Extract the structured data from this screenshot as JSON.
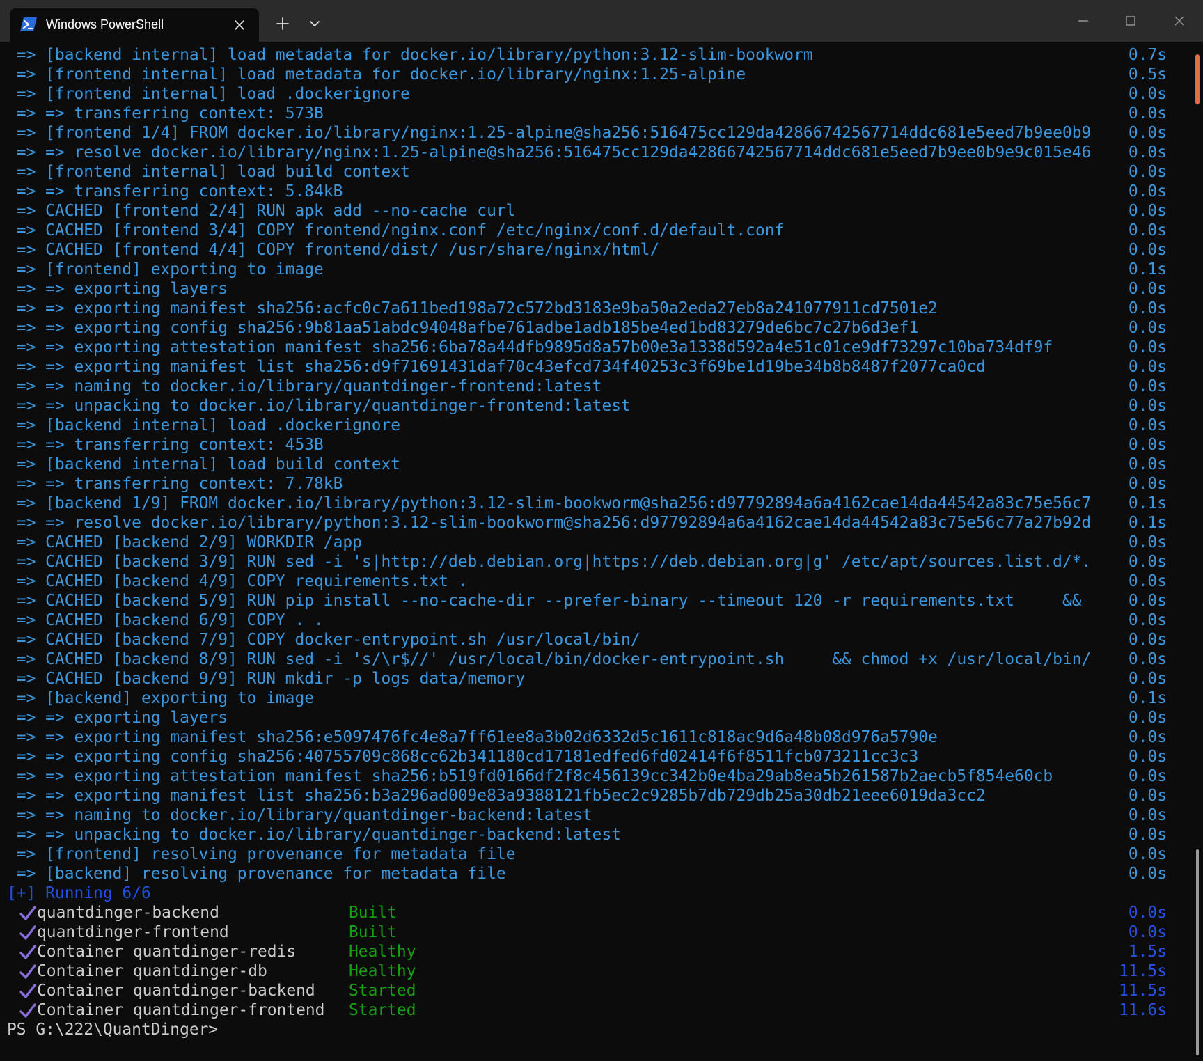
{
  "titlebar": {
    "tab_title": "Windows PowerShell",
    "tab_icon": "powershell-icon",
    "new_tab_icon": "plus-icon",
    "dropdown_icon": "chevron-down-icon",
    "minimize_icon": "minimize-icon",
    "maximize_icon": "maximize-icon",
    "close_icon": "close-icon"
  },
  "log": [
    {
      "text": " => [backend internal] load metadata for docker.io/library/python:3.12-slim-bookworm",
      "time": "0.7s"
    },
    {
      "text": " => [frontend internal] load metadata for docker.io/library/nginx:1.25-alpine",
      "time": "0.5s"
    },
    {
      "text": " => [frontend internal] load .dockerignore",
      "time": "0.0s"
    },
    {
      "text": " => => transferring context: 573B",
      "time": "0.0s"
    },
    {
      "text": " => [frontend 1/4] FROM docker.io/library/nginx:1.25-alpine@sha256:516475cc129da42866742567714ddc681e5eed7b9ee0b9",
      "time": "0.0s"
    },
    {
      "text": " => => resolve docker.io/library/nginx:1.25-alpine@sha256:516475cc129da42866742567714ddc681e5eed7b9ee0b9e9c015e46",
      "time": "0.0s"
    },
    {
      "text": " => [frontend internal] load build context",
      "time": "0.0s"
    },
    {
      "text": " => => transferring context: 5.84kB",
      "time": "0.0s"
    },
    {
      "text": " => CACHED [frontend 2/4] RUN apk add --no-cache curl",
      "time": "0.0s"
    },
    {
      "text": " => CACHED [frontend 3/4] COPY frontend/nginx.conf /etc/nginx/conf.d/default.conf",
      "time": "0.0s"
    },
    {
      "text": " => CACHED [frontend 4/4] COPY frontend/dist/ /usr/share/nginx/html/",
      "time": "0.0s"
    },
    {
      "text": " => [frontend] exporting to image",
      "time": "0.1s"
    },
    {
      "text": " => => exporting layers",
      "time": "0.0s"
    },
    {
      "text": " => => exporting manifest sha256:acfc0c7a611bed198a72c572bd3183e9ba50a2eda27eb8a241077911cd7501e2",
      "time": "0.0s"
    },
    {
      "text": " => => exporting config sha256:9b81aa51abdc94048afbe761adbe1adb185be4ed1bd83279de6bc7c27b6d3ef1",
      "time": "0.0s"
    },
    {
      "text": " => => exporting attestation manifest sha256:6ba78a44dfb9895d8a57b00e3a1338d592a4e51c01ce9df73297c10ba734df9f",
      "time": "0.0s"
    },
    {
      "text": " => => exporting manifest list sha256:d9f71691431daf70c43efcd734f40253c3f69be1d19be34b8b8487f2077ca0cd",
      "time": "0.0s"
    },
    {
      "text": " => => naming to docker.io/library/quantdinger-frontend:latest",
      "time": "0.0s"
    },
    {
      "text": " => => unpacking to docker.io/library/quantdinger-frontend:latest",
      "time": "0.0s"
    },
    {
      "text": " => [backend internal] load .dockerignore",
      "time": "0.0s"
    },
    {
      "text": " => => transferring context: 453B",
      "time": "0.0s"
    },
    {
      "text": " => [backend internal] load build context",
      "time": "0.0s"
    },
    {
      "text": " => => transferring context: 7.78kB",
      "time": "0.0s"
    },
    {
      "text": " => [backend 1/9] FROM docker.io/library/python:3.12-slim-bookworm@sha256:d97792894a6a4162cae14da44542a83c75e56c7",
      "time": "0.1s"
    },
    {
      "text": " => => resolve docker.io/library/python:3.12-slim-bookworm@sha256:d97792894a6a4162cae14da44542a83c75e56c77a27b92d",
      "time": "0.1s"
    },
    {
      "text": " => CACHED [backend 2/9] WORKDIR /app",
      "time": "0.0s"
    },
    {
      "text": " => CACHED [backend 3/9] RUN sed -i 's|http://deb.debian.org|https://deb.debian.org|g' /etc/apt/sources.list.d/*.",
      "time": "0.0s"
    },
    {
      "text": " => CACHED [backend 4/9] COPY requirements.txt .",
      "time": "0.0s"
    },
    {
      "text": " => CACHED [backend 5/9] RUN pip install --no-cache-dir --prefer-binary --timeout 120 -r requirements.txt     &&",
      "time": "0.0s"
    },
    {
      "text": " => CACHED [backend 6/9] COPY . .",
      "time": "0.0s"
    },
    {
      "text": " => CACHED [backend 7/9] COPY docker-entrypoint.sh /usr/local/bin/",
      "time": "0.0s"
    },
    {
      "text": " => CACHED [backend 8/9] RUN sed -i 's/\\r$//' /usr/local/bin/docker-entrypoint.sh     && chmod +x /usr/local/bin/",
      "time": "0.0s"
    },
    {
      "text": " => CACHED [backend 9/9] RUN mkdir -p logs data/memory",
      "time": "0.0s"
    },
    {
      "text": " => [backend] exporting to image",
      "time": "0.1s"
    },
    {
      "text": " => => exporting layers",
      "time": "0.0s"
    },
    {
      "text": " => => exporting manifest sha256:e5097476fc4e8a7ff61ee8a3b02d6332d5c1611c818ac9d6a48b08d976a5790e",
      "time": "0.0s"
    },
    {
      "text": " => => exporting config sha256:40755709c868cc62b341180cd17181edfed6fd02414f6f8511fcb073211cc3c3",
      "time": "0.0s"
    },
    {
      "text": " => => exporting attestation manifest sha256:b519fd0166df2f8c456139cc342b0e4ba29ab8ea5b261587b2aecb5f854e60cb",
      "time": "0.0s"
    },
    {
      "text": " => => exporting manifest list sha256:b3a296ad009e83a9388121fb5ec2c9285b7db729db25a30db21eee6019da3cc2",
      "time": "0.0s"
    },
    {
      "text": " => => naming to docker.io/library/quantdinger-backend:latest",
      "time": "0.0s"
    },
    {
      "text": " => => unpacking to docker.io/library/quantdinger-backend:latest",
      "time": "0.0s"
    },
    {
      "text": " => [frontend] resolving provenance for metadata file",
      "time": "0.0s"
    },
    {
      "text": " => [backend] resolving provenance for metadata file",
      "time": "0.0s"
    }
  ],
  "running_header": "[+] Running 6/6",
  "check_icon": "checkmark-icon",
  "status_rows": [
    {
      "name": "quantdinger-backend",
      "status": "Built",
      "time": "0.0s"
    },
    {
      "name": "quantdinger-frontend",
      "status": "Built",
      "time": "0.0s"
    },
    {
      "name": "Container quantdinger-redis",
      "status": "Healthy",
      "time": "1.5s"
    },
    {
      "name": "Container quantdinger-db",
      "status": "Healthy",
      "time": "11.5s"
    },
    {
      "name": "Container quantdinger-backend",
      "status": "Started",
      "time": "11.5s"
    },
    {
      "name": "Container quantdinger-frontend",
      "status": "Started",
      "time": "11.6s"
    }
  ],
  "prompt": "PS G:\\222\\QuantDinger>",
  "colors": {
    "log_text": "#3a96dd",
    "running_header": "#1f4fe0",
    "status_green": "#13a10e",
    "check_purple": "#8a6fdc",
    "prompt_text": "#cccccc"
  }
}
